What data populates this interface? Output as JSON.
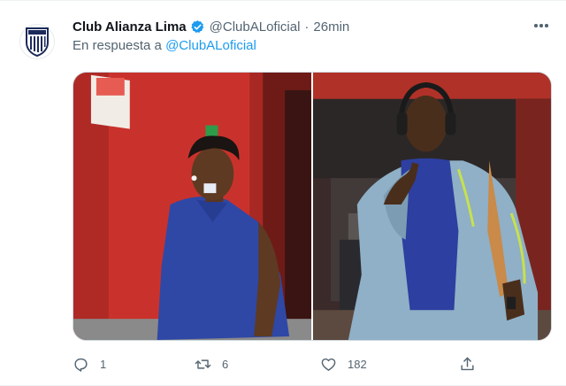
{
  "tweet": {
    "author_name": "Club Alianza Lima",
    "handle": "@ClubALoficial",
    "separator": "·",
    "time": "26min",
    "reply_prefix": "En respuesta a",
    "reply_to": "@ClubALoficial"
  },
  "actions": {
    "reply_count": "1",
    "retweet_count": "6",
    "like_count": "182"
  },
  "colors": {
    "accent": "#1d9bf0",
    "secondary_text": "#536471",
    "verified": "#1d9bf0"
  },
  "icons": [
    "club-crest-icon",
    "verified-badge-icon",
    "more-icon",
    "reply-icon",
    "retweet-icon",
    "like-icon",
    "share-icon"
  ]
}
